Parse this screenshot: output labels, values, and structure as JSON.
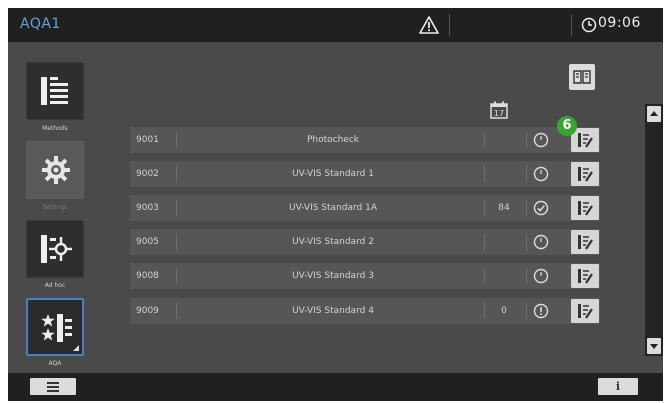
{
  "header": {
    "title": "AQA1",
    "time": "09:06",
    "warning_icon": "warning-triangle-icon",
    "clock_icon": "clock-icon"
  },
  "sidebar": {
    "items": [
      {
        "label": "Methods",
        "icon": "methods-list-icon"
      },
      {
        "label": "Settings",
        "icon": "gear-icon"
      },
      {
        "label": "Ad hoc",
        "icon": "adhoc-measure-icon"
      },
      {
        "label": "AQA",
        "icon": "aqa-stars-icon"
      }
    ]
  },
  "toolbar": {
    "book_icon": "book-icon",
    "calendar_icon": "calendar-icon",
    "calendar_day": "17"
  },
  "callout": {
    "number": "6",
    "color": "#3aa335"
  },
  "table": {
    "rows": [
      {
        "id": "9001",
        "name": "Photocheck",
        "count": "",
        "status": "pending"
      },
      {
        "id": "9002",
        "name": "UV-VIS Standard 1",
        "count": "",
        "status": "pending"
      },
      {
        "id": "9003",
        "name": "UV-VIS Standard 1A",
        "count": "84",
        "status": "ok"
      },
      {
        "id": "9005",
        "name": "UV-VIS Standard 2",
        "count": "",
        "status": "pending"
      },
      {
        "id": "9008",
        "name": "UV-VIS Standard 3",
        "count": "",
        "status": "pending"
      },
      {
        "id": "9009",
        "name": "UV-VIS Standard 4",
        "count": "0",
        "status": "warning"
      }
    ]
  },
  "footer": {
    "info_label": "i"
  },
  "colors": {
    "accent": "#4b7ec2",
    "title": "#6b9fd6",
    "background": "#4a4a4a",
    "bar": "#202020"
  }
}
